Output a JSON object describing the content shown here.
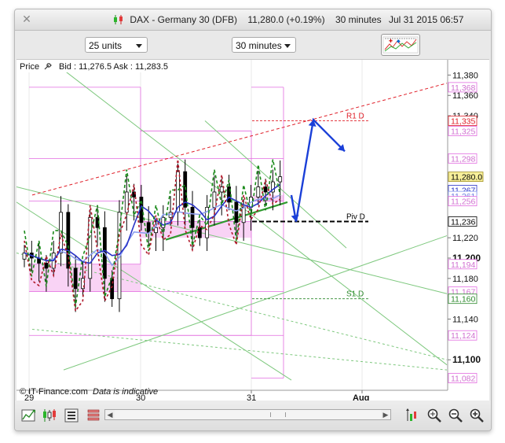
{
  "window": {
    "title": "DAX - Germany 30 (DFB)",
    "last_price": "11,280.0",
    "change": "(+0.19%)",
    "timeframe": "30 minutes",
    "datetime": "Jul 31 2015 06:57"
  },
  "controls": {
    "units_select": "25 units",
    "timeframe_select": "30 minutes"
  },
  "chart_header": {
    "price_label": "Price",
    "bid_ask": "Bid : 11,276.5 Ask : 11,283.5"
  },
  "footer": {
    "copyright": "© IT-Finance.com",
    "note": "Data is indicative"
  },
  "colors": {
    "up_candle": "#ffffff",
    "down_candle": "#000000",
    "resistance": "#e0202a",
    "support": "#2d8a2d",
    "pivot": "#000000",
    "arrow": "#1a3fd8",
    "envelope": "#e26be0",
    "channel_green": "#7ec87e",
    "ma_blue": "#2a34c8",
    "ma_lightblue": "#8d9ff0",
    "current_price_bg": "#f7ef9a"
  },
  "chart_data": {
    "type": "candlestick",
    "x_ticks": [
      "29",
      "30",
      "31",
      "Aug"
    ],
    "y_ticks": [
      "11,380",
      "11,360",
      "11,340",
      "11,320",
      "11,300",
      "11,280",
      "11,260",
      "11,240",
      "11,220",
      "11,200",
      "11,180",
      "11,160",
      "11,140",
      "11,120",
      "11,100"
    ],
    "y_tick_labels": [
      {
        "text": "11,380",
        "value": 11380,
        "bold": false
      },
      {
        "text": "11,360",
        "value": 11360,
        "bold": false
      },
      {
        "text": "11,340",
        "value": 11340,
        "bold": false
      },
      {
        "text": "11,220",
        "value": 11220,
        "bold": false
      },
      {
        "text": "11,200",
        "value": 11200,
        "bold": true
      },
      {
        "text": "11,180",
        "value": 11180,
        "bold": false
      },
      {
        "text": "11,140",
        "value": 11140,
        "bold": false
      },
      {
        "text": "11,100",
        "value": 11100,
        "bold": true
      }
    ],
    "ylim": [
      11070,
      11395
    ],
    "level_boxes": [
      {
        "text": "11,368",
        "value": 11368,
        "kind": "envelope"
      },
      {
        "text": "11,335",
        "value": 11335,
        "kind": "resistance"
      },
      {
        "text": "11,325",
        "value": 11325,
        "kind": "envelope"
      },
      {
        "text": "11,298",
        "value": 11298,
        "kind": "envelope"
      },
      {
        "text": "11,280.0",
        "value": 11280,
        "kind": "current"
      },
      {
        "text": "11,267",
        "value": 11267,
        "kind": "ma_blue"
      },
      {
        "text": "11,261",
        "value": 11261,
        "kind": "ma_light"
      },
      {
        "text": "11,256",
        "value": 11256,
        "kind": "envelope"
      },
      {
        "text": "11,236",
        "value": 11236,
        "kind": "pivot"
      },
      {
        "text": "11,194",
        "value": 11194,
        "kind": "envelope"
      },
      {
        "text": "11,167",
        "value": 11167,
        "kind": "envelope"
      },
      {
        "text": "11,160",
        "value": 11160,
        "kind": "support"
      },
      {
        "text": "11,124",
        "value": 11124,
        "kind": "envelope"
      },
      {
        "text": "11,082",
        "value": 11082,
        "kind": "envelope"
      }
    ],
    "levels": [
      {
        "name": "R1 D",
        "value": 11335,
        "color": "#e0202a"
      },
      {
        "name": "Piv D",
        "value": 11236,
        "color": "#000000"
      },
      {
        "name": "S1 D",
        "value": 11160,
        "color": "#2d8a2d"
      }
    ],
    "series": [
      {
        "name": "candles",
        "values": [
          11205,
          11200,
          11195,
          11190,
          11205,
          11245,
          11190,
          11170,
          11180,
          11240,
          11230,
          11180,
          11160,
          11245,
          11265,
          11260,
          11235,
          11225,
          11230,
          11240,
          11245,
          11285,
          11250,
          11230,
          11220,
          11250,
          11265,
          11270,
          11255,
          11235,
          11250,
          11260,
          11270,
          11265,
          11275,
          11280
        ]
      }
    ],
    "forecast_path": [
      11262,
      11236,
      11336,
      11305
    ]
  }
}
